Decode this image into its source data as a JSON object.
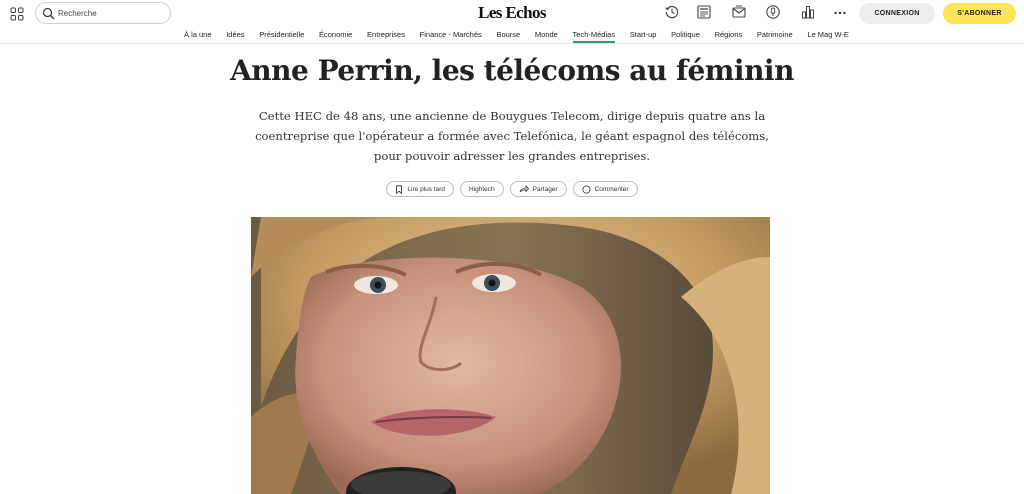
{
  "header": {
    "search": {
      "placeholder": "Recherche",
      "icon": "search-icon"
    },
    "logo": "Les Echos",
    "icons": [
      "clock-icon",
      "newspaper-icon",
      "mail-icon",
      "podcast-icon",
      "chart-bars-icon",
      "more-icon"
    ],
    "login_label": "CONNEXION",
    "subscribe_label": "S'ABONNER",
    "subscribe_color": "#fee558"
  },
  "nav": {
    "items": [
      "À la une",
      "Idées",
      "Présidentielle",
      "Économie",
      "Entreprises",
      "Finance - Marchés",
      "Bourse",
      "Monde",
      "Tech-Médias",
      "Start-up",
      "Politique",
      "Régions",
      "Patrimoine",
      "Le Mag W-E"
    ],
    "active": "Tech-Médias",
    "active_color": "#2e9e64"
  },
  "article": {
    "title": "Anne Perrin, les télécoms au féminin",
    "lede": "Cette HEC de 48 ans, une ancienne de Bouygues Telecom, dirige depuis quatre ans la coentreprise que l'opérateur a formée avec Telefónica, le géant espagnol des télécoms, pour pouvoir adresser les grandes entreprises.",
    "actions": {
      "save": "Lire plus tard",
      "topic": "Hightech",
      "share": "Partager",
      "comment": "Commenter"
    }
  }
}
